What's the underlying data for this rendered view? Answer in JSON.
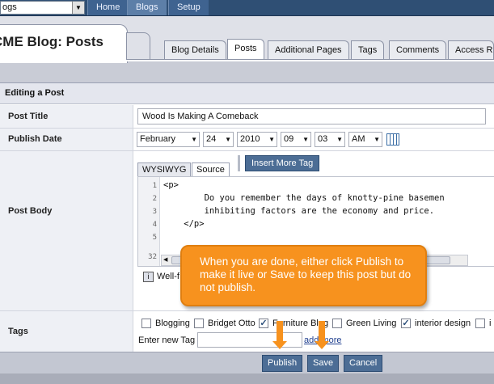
{
  "topnav": {
    "site_selector_value": "ogs",
    "items": [
      "Home",
      "Blogs",
      "Setup"
    ]
  },
  "page_title": "CME Blog: Posts",
  "tabs": [
    "Blog Details",
    "Posts",
    "Additional Pages",
    "Tags",
    "Comments",
    "Access R"
  ],
  "active_tab": "Posts",
  "section_heading": "Editing a Post",
  "form": {
    "post_title_label": "Post Title",
    "post_title_value": "Wood Is Making A Comeback",
    "publish_date_label": "Publish Date",
    "date": {
      "month": "February",
      "day": "24",
      "year": "2010",
      "hour": "09",
      "minute": "03",
      "ampm": "AM"
    },
    "post_body_label": "Post Body",
    "editor_tabs": [
      "WYSIWYG",
      "Source"
    ],
    "insert_more_tag": "Insert More Tag",
    "code_lines": [
      {
        "num": "1",
        "text": "<p>"
      },
      {
        "num": "2",
        "text": "        Do you remember the days of knotty-pine basemen"
      },
      {
        "num": "3",
        "text": "        inhibiting factors are the economy and price."
      },
      {
        "num": "4",
        "text": "    </p>"
      },
      {
        "num": "5",
        "text": ""
      },
      {
        "num": "32",
        "text": ""
      }
    ],
    "wellformed_note": "Well-f",
    "tags_label": "Tags",
    "tag_options": [
      {
        "label": "Blogging",
        "checked": false
      },
      {
        "label": "Bridget Otto",
        "checked": false
      },
      {
        "label": "Furniture Blog",
        "checked": true
      },
      {
        "label": "Green Living",
        "checked": false
      },
      {
        "label": "interior design",
        "checked": true
      },
      {
        "label": "i",
        "checked": false
      }
    ],
    "new_tag_label": "Enter new Tag",
    "add_more_link": "add more"
  },
  "buttons": {
    "publish": "Publish",
    "save": "Save",
    "cancel": "Cancel"
  },
  "callout_text": "When you are done, either click Publish to make it live or Save to keep this post but do not publish.",
  "colors": {
    "nav_bg": "#2f4f74",
    "button_bg": "#4c6d95",
    "callout": "#f7921e"
  }
}
